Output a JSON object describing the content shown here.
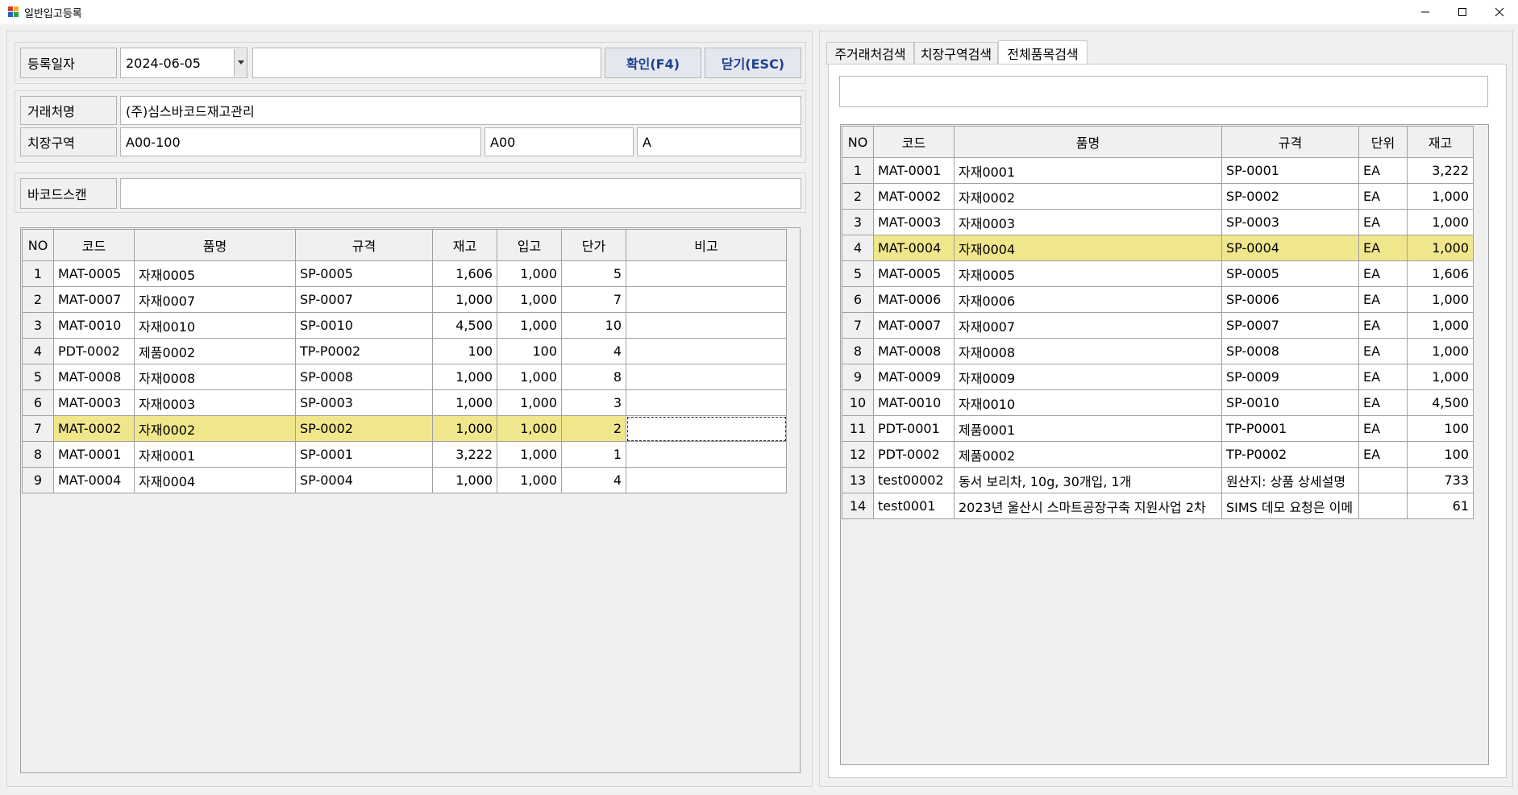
{
  "window": {
    "title": "일반입고등록"
  },
  "form": {
    "date_label": "등록일자",
    "date_value": "2024-06-05",
    "memo_value": "",
    "confirm_button": "확인(F4)",
    "close_button": "닫기(ESC)",
    "client_label": "거래처명",
    "client_value": "(주)심스바코드재고관리",
    "location_label": "치장구역",
    "location_value1": "A00-100",
    "location_value2": "A00",
    "location_value3": "A",
    "barcode_label": "바코드스캔",
    "barcode_value": ""
  },
  "left_grid": {
    "columns": [
      "NO",
      "코드",
      "품명",
      "규격",
      "재고",
      "입고",
      "단가",
      "비고"
    ],
    "selected_row": 7,
    "rows": [
      [
        "1",
        "MAT-0005",
        "자재0005",
        "SP-0005",
        "1,606",
        "1,000",
        "5",
        ""
      ],
      [
        "2",
        "MAT-0007",
        "자재0007",
        "SP-0007",
        "1,000",
        "1,000",
        "7",
        ""
      ],
      [
        "3",
        "MAT-0010",
        "자재0010",
        "SP-0010",
        "4,500",
        "1,000",
        "10",
        ""
      ],
      [
        "4",
        "PDT-0002",
        "제품0002",
        "TP-P0002",
        "100",
        "100",
        "4",
        ""
      ],
      [
        "5",
        "MAT-0008",
        "자재0008",
        "SP-0008",
        "1,000",
        "1,000",
        "8",
        ""
      ],
      [
        "6",
        "MAT-0003",
        "자재0003",
        "SP-0003",
        "1,000",
        "1,000",
        "3",
        ""
      ],
      [
        "7",
        "MAT-0002",
        "자재0002",
        "SP-0002",
        "1,000",
        "1,000",
        "2",
        ""
      ],
      [
        "8",
        "MAT-0001",
        "자재0001",
        "SP-0001",
        "3,222",
        "1,000",
        "1",
        ""
      ],
      [
        "9",
        "MAT-0004",
        "자재0004",
        "SP-0004",
        "1,000",
        "1,000",
        "4",
        ""
      ]
    ]
  },
  "right_panel": {
    "tabs": [
      "주거래처검색",
      "치장구역검색",
      "전체품목검색"
    ],
    "active_tab": 2,
    "search_value": "",
    "columns": [
      "NO",
      "코드",
      "품명",
      "규격",
      "단위",
      "재고"
    ],
    "selected_row": 4,
    "rows": [
      [
        "1",
        "MAT-0001",
        "자재0001",
        "SP-0001",
        "EA",
        "3,222"
      ],
      [
        "2",
        "MAT-0002",
        "자재0002",
        "SP-0002",
        "EA",
        "1,000"
      ],
      [
        "3",
        "MAT-0003",
        "자재0003",
        "SP-0003",
        "EA",
        "1,000"
      ],
      [
        "4",
        "MAT-0004",
        "자재0004",
        "SP-0004",
        "EA",
        "1,000"
      ],
      [
        "5",
        "MAT-0005",
        "자재0005",
        "SP-0005",
        "EA",
        "1,606"
      ],
      [
        "6",
        "MAT-0006",
        "자재0006",
        "SP-0006",
        "EA",
        "1,000"
      ],
      [
        "7",
        "MAT-0007",
        "자재0007",
        "SP-0007",
        "EA",
        "1,000"
      ],
      [
        "8",
        "MAT-0008",
        "자재0008",
        "SP-0008",
        "EA",
        "1,000"
      ],
      [
        "9",
        "MAT-0009",
        "자재0009",
        "SP-0009",
        "EA",
        "1,000"
      ],
      [
        "10",
        "MAT-0010",
        "자재0010",
        "SP-0010",
        "EA",
        "4,500"
      ],
      [
        "11",
        "PDT-0001",
        "제품0001",
        "TP-P0001",
        "EA",
        "100"
      ],
      [
        "12",
        "PDT-0002",
        "제품0002",
        "TP-P0002",
        "EA",
        "100"
      ],
      [
        "13",
        "test00002",
        "동서 보리차, 10g, 30개입, 1개",
        "원산지: 상품 상세설명",
        "",
        "733"
      ],
      [
        "14",
        "test0001",
        "2023년 울산시 스마트공장구축 지원사업 2차",
        "SIMS 데모 요청은 이메",
        "",
        "61"
      ]
    ]
  },
  "colors": {
    "selected_row_bg": "#f0e68c",
    "button_text": "#1f3f8f"
  }
}
